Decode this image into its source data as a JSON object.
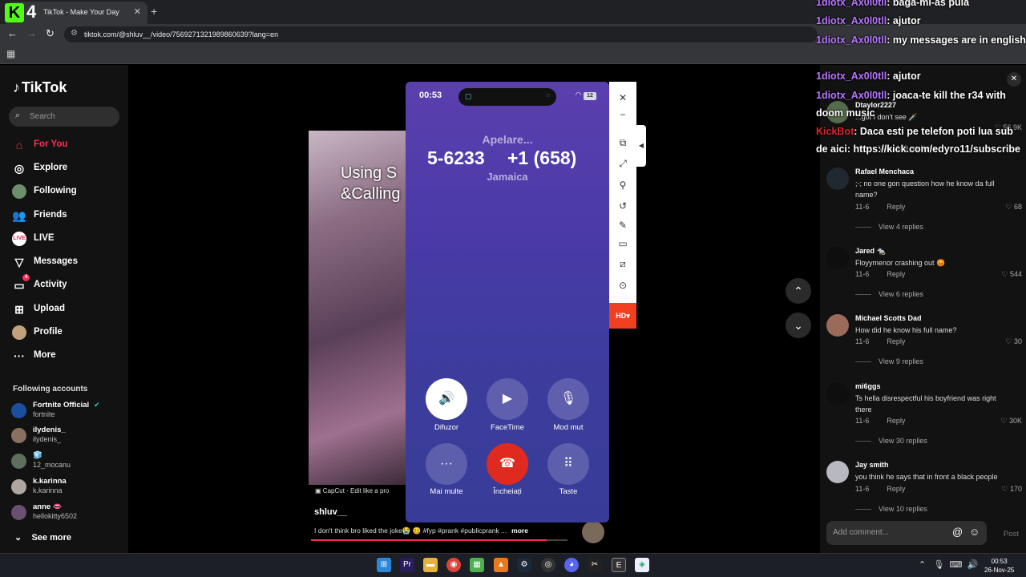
{
  "browser": {
    "tab_title": "TikTok - Make Your Day",
    "url": "tiktok.com/@shluv__/video/7569271321989860639?lang=en",
    "close_tab": "✕",
    "new_tab": "+",
    "overlay_logo": "K",
    "overlay_number": "4"
  },
  "sidebar": {
    "logo": "TikTok",
    "search_placeholder": "Search",
    "nav": [
      {
        "label": "For You",
        "icon": "home-icon"
      },
      {
        "label": "Explore",
        "icon": "compass-icon"
      },
      {
        "label": "Following",
        "icon": "following-avatar-icon"
      },
      {
        "label": "Friends",
        "icon": "friends-icon"
      },
      {
        "label": "LIVE",
        "icon": "live-icon"
      },
      {
        "label": "Messages",
        "icon": "messages-icon"
      },
      {
        "label": "Activity",
        "icon": "activity-icon",
        "badge": "4"
      },
      {
        "label": "Upload",
        "icon": "upload-icon"
      },
      {
        "label": "Profile",
        "icon": "profile-avatar-icon"
      },
      {
        "label": "More",
        "icon": "more-icon"
      }
    ],
    "following_title": "Following accounts",
    "accounts": [
      {
        "name": "Fortnite Official",
        "handle": "fortnite",
        "verified": true
      },
      {
        "name": "ilydenis_",
        "handle": "ilydenis_"
      },
      {
        "name": "🧊",
        "handle": "12_mocanu"
      },
      {
        "name": "k.karinna",
        "handle": "k.karinna"
      },
      {
        "name": "anne 👄",
        "handle": "hellokitty6502"
      }
    ],
    "see_more": "See more"
  },
  "video": {
    "caption_line1": "Using S",
    "caption_line2": "&Calling",
    "capcut": "CapCut · Edit like a pro",
    "author": "shluv__",
    "description": "I don't think bro liked the joke😭 🥴 #fyp #prank #publicprank ...",
    "more": "more",
    "progress": 0.92
  },
  "phone": {
    "time": "00:53",
    "battery": "12",
    "status": "Apelare...",
    "number_part1": "5-6233",
    "number_part2": "+1 (658)",
    "location": "Jamaica",
    "buttons": [
      {
        "label": "Difuzor",
        "icon": "speaker-icon"
      },
      {
        "label": "FaceTime",
        "icon": "facetime-icon"
      },
      {
        "label": "Mod mut",
        "icon": "mute-icon"
      },
      {
        "label": "Mai multe",
        "icon": "more-dots-icon"
      },
      {
        "label": "Încheiați",
        "icon": "end-call-icon"
      },
      {
        "label": "Taste",
        "icon": "keypad-icon"
      }
    ],
    "hd": "HD"
  },
  "comments": [
    {
      "user": "Dtaylor2227",
      "text": "...got I don't see 🗡️",
      "likes": "56.9K",
      "replies": "View 139 replies"
    },
    {
      "user": "Rafael Menchaca",
      "text": ";-; no one gon question how he know da full name?",
      "date": "11-6",
      "likes": "68",
      "replies": "View 4 replies"
    },
    {
      "user": "Jared 🐀",
      "text": "Floyymenor crashing out 😡",
      "date": "11-6",
      "likes": "544",
      "replies": "View 6 replies"
    },
    {
      "user": "Michael Scotts Dad",
      "text": "How did he know his full name?",
      "date": "11-6",
      "likes": "30",
      "replies": "View 9 replies"
    },
    {
      "user": "mi6ggs",
      "text": "Ts hella disrespectful his boyfriend was right there",
      "date": "11-6",
      "likes": "30K",
      "replies": "View 30 replies"
    },
    {
      "user": "Jay smith",
      "text": "you think he says that in front a black people",
      "date": "11-6",
      "likes": "170",
      "replies": "View 10 replies"
    }
  ],
  "reply_label": "Reply",
  "add_comment_placeholder": "Add comment...",
  "post_label": "Post",
  "chat": [
    {
      "user": "1diotx_Ax0l0tll",
      "msg": ": baga-mi-as pula"
    },
    {
      "user": "1diotx_Ax0l0tll",
      "msg": ": ajutor"
    },
    {
      "user": "1diotx_Ax0l0tll",
      "msg": ": my messages are in english"
    },
    {
      "user": "1diotx_Ax0l0tll",
      "msg": ": ajutor"
    },
    {
      "user": "1diotx_Ax0l0tll",
      "msg": ": joaca-te kill the r34 with doom music"
    },
    {
      "user": "KickBot",
      "msg": ": Daca esti pe telefon poti lua sub de aici: https://kick.com/edyro11/subscribe"
    }
  ],
  "taskbar": {
    "time": "00:53",
    "date": "26-Nov-25"
  },
  "colors": {
    "tiktok_red": "#fe2c55",
    "chat_user": "#b776ff",
    "kick_green": "#53fc18",
    "end_call": "#e02a1f"
  }
}
